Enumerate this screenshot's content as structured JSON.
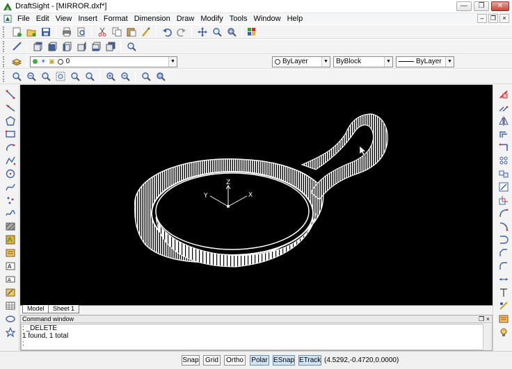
{
  "titlebar": {
    "title": "DraftSight - [MIRROR.dxf*]",
    "controls": [
      "minimize",
      "restore",
      "close"
    ]
  },
  "menubar": {
    "items": [
      "File",
      "Edit",
      "View",
      "Insert",
      "Format",
      "Dimension",
      "Draw",
      "Modify",
      "Tools",
      "Window",
      "Help"
    ]
  },
  "toolbar_standard": {
    "icons": [
      "new-icon",
      "open-icon",
      "save-icon",
      "print-icon",
      "print-preview-icon",
      "cut-icon",
      "copy-icon",
      "paste-icon",
      "match-properties-icon",
      "undo-icon",
      "redo-icon",
      "pan-icon",
      "zoom-realtime-icon",
      "zoom-window-icon",
      "design-resources-icon"
    ]
  },
  "toolbar_views": {
    "icons": [
      "top-view-icon",
      "front-view-icon",
      "left-view-icon",
      "right-view-icon",
      "bottom-view-icon",
      "back-view-icon",
      "iso-view-icon"
    ]
  },
  "layer_toolbar": {
    "layer_value": "0",
    "color_value": "ByLayer",
    "linestyle_value": "ByBlock",
    "lineweight_value": "ByLayer"
  },
  "toolbar_zoom": {
    "icons": [
      "zoom-fit-icon",
      "zoom-bounds-icon",
      "zoom-window-icon",
      "zoom-previous-icon",
      "zoom-next-icon",
      "zoom-selection-icon",
      "zoom-in-icon",
      "zoom-out-icon",
      "zoom-realtime-icon",
      "zoom-all-icon"
    ]
  },
  "left_toolbar": {
    "icons": [
      "line-icon",
      "infinite-line-icon",
      "polygon-icon",
      "rectangle-icon",
      "arc-icon",
      "polyline-icon",
      "circle-icon",
      "spline-icon",
      "point-icon",
      "freehand-icon",
      "hatch-icon",
      "block-icon",
      "region-icon",
      "note-icon",
      "simple-note-icon",
      "attach-icon",
      "table-icon",
      "ellipse-icon",
      "star-icon"
    ]
  },
  "right_toolbar": {
    "icons": [
      "delete-icon",
      "copy-entity-icon",
      "mirror-icon",
      "offset-icon",
      "pattern-icon",
      "move-icon",
      "rotate-icon",
      "scale-icon",
      "stretch-icon",
      "trim-icon",
      "extend-icon",
      "break-icon",
      "chamfer-icon",
      "fillet-icon",
      "explode-icon",
      "dimension-icon",
      "properties-icon",
      "palette-icon",
      "render-icon"
    ]
  },
  "tabs": {
    "model": "Model",
    "sheet": "Sheet 1"
  },
  "axis": {
    "z": "Z",
    "x": "X",
    "y": "Y"
  },
  "command_window": {
    "title": "Command window",
    "lines": [
      ": _DELETE",
      "1 found, 1 total",
      ":"
    ]
  },
  "statusbar": {
    "buttons": [
      {
        "label": "Snap",
        "on": false
      },
      {
        "label": "Grid",
        "on": false
      },
      {
        "label": "Ortho",
        "on": false
      },
      {
        "label": "Polar",
        "on": true
      },
      {
        "label": "ESnap",
        "on": true
      },
      {
        "label": "ETrack",
        "on": true
      }
    ],
    "coordinates": "(4.5292,-0.4720,0.0000)"
  }
}
